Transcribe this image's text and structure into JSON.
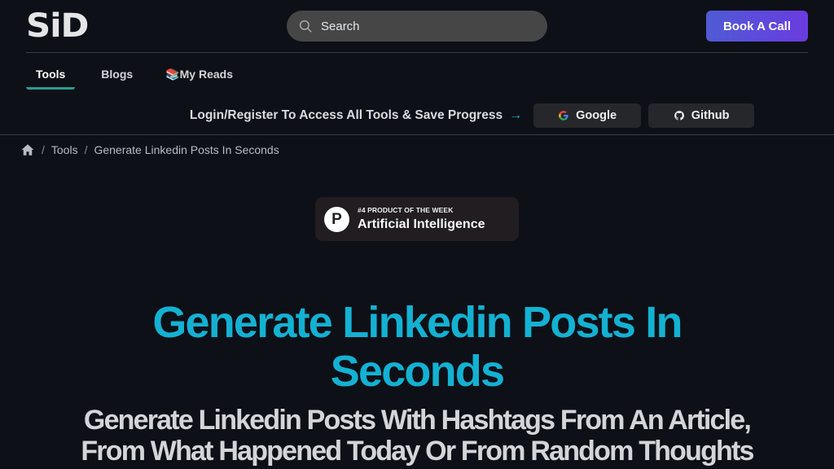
{
  "header": {
    "logo": "SiD",
    "search_placeholder": "Search",
    "book_call_label": "Book A Call"
  },
  "nav": {
    "items": [
      {
        "label": "Tools",
        "active": true
      },
      {
        "label": "Blogs",
        "active": false
      },
      {
        "emoji": "📚",
        "label": "My Reads",
        "active": false
      }
    ]
  },
  "login_banner": {
    "text": "Login/Register To Access All Tools & Save Progress",
    "arrow": "→",
    "google_label": "Google",
    "github_label": "Github"
  },
  "breadcrumb": {
    "separator": "/",
    "items": [
      "Tools",
      "Generate Linkedin Posts In Seconds"
    ]
  },
  "product_hunt_badge": {
    "logo_letter": "P",
    "rank_text": "#4 PRODUCT OF THE WEEK",
    "category": "Artificial Intelligence"
  },
  "hero": {
    "title": "Generate Linkedin Posts In Seconds",
    "subtitle": "Generate Linkedin Posts With Hashtags From An Article, From What Happened Today Or From Random Thoughts"
  },
  "colors": {
    "background": "#0d1016",
    "accent_title": "#14b1d3",
    "nav_active_underline": "#2a9d8f",
    "book_call_gradient_start": "#4f5bd5",
    "book_call_gradient_end": "#6a3be0"
  }
}
